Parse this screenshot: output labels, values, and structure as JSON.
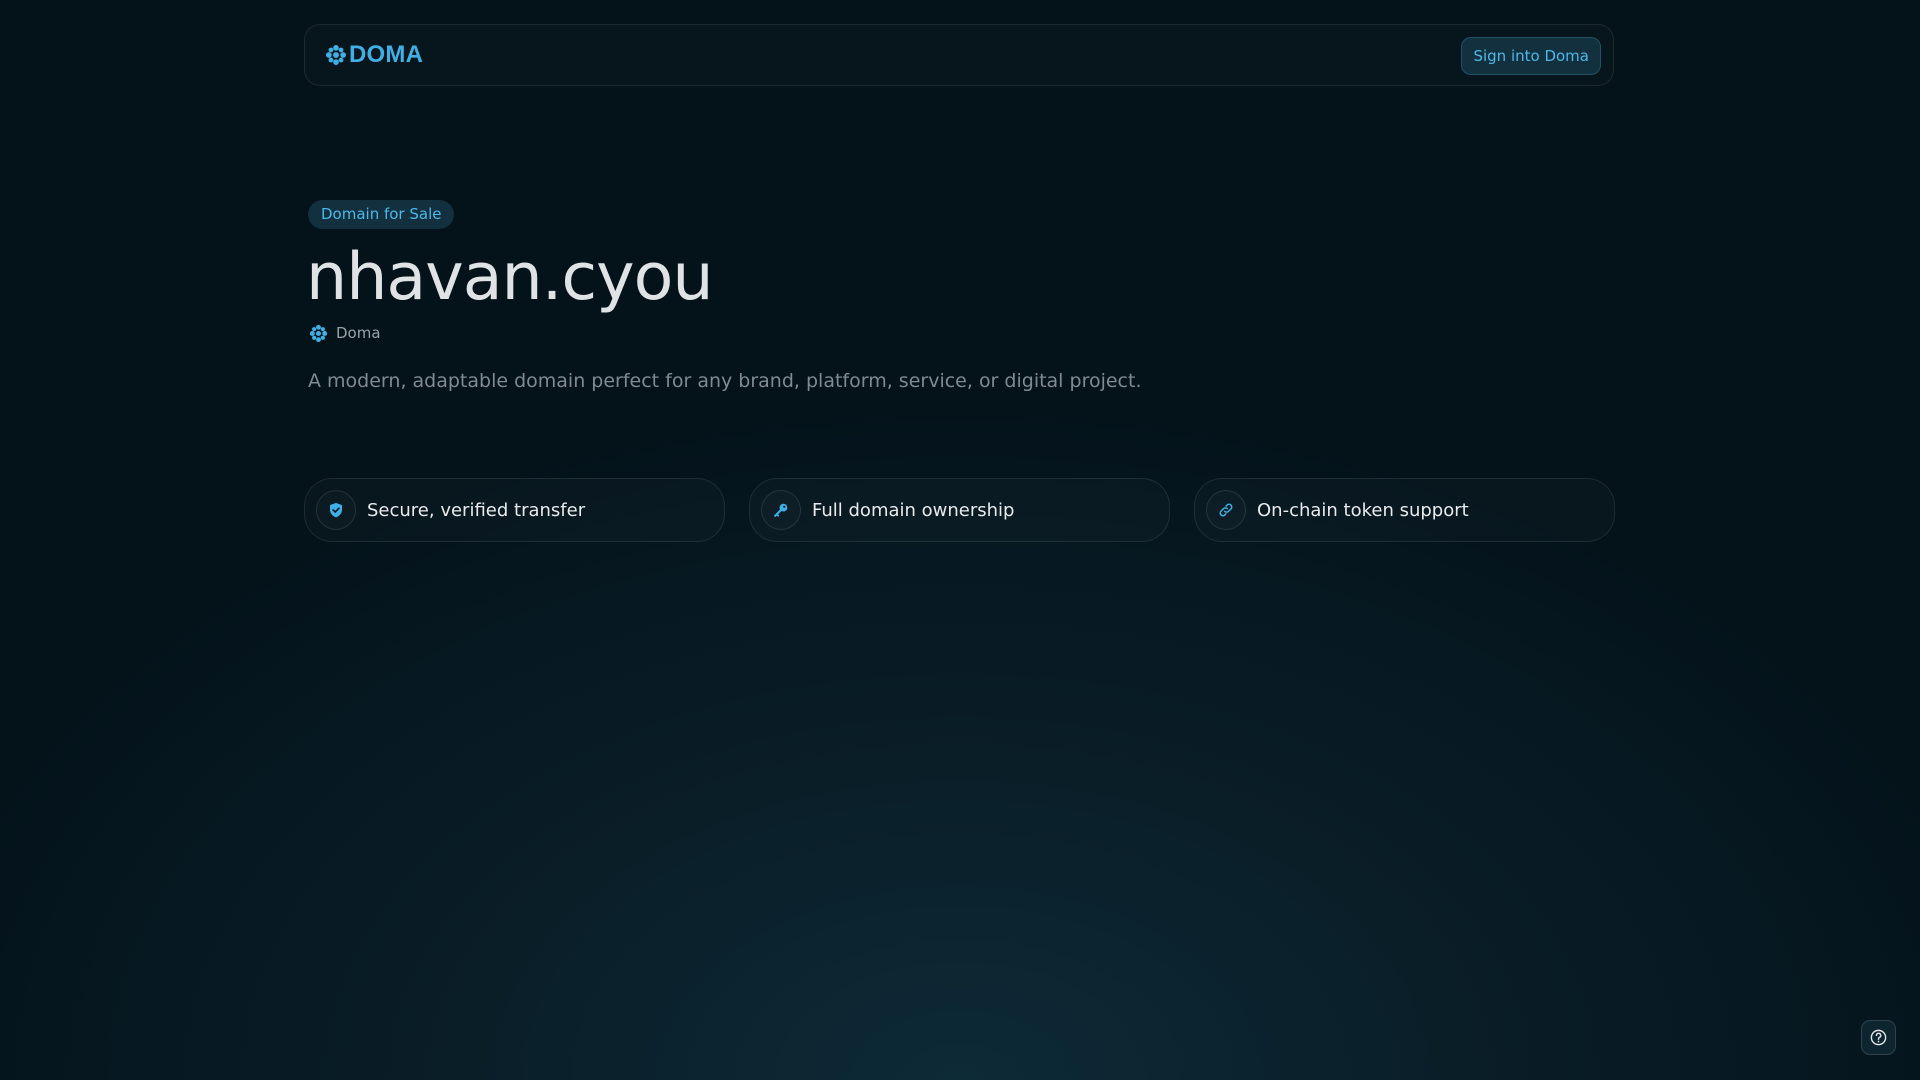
{
  "header": {
    "logo_text": "DOMA",
    "logo_icon": "doma-flower-icon",
    "signin_label": "Sign into Doma"
  },
  "listing": {
    "badge": "Domain for Sale",
    "domain": "nhavan.cyou",
    "registrar": "Doma",
    "registrar_icon": "doma-flower-icon",
    "description": "A modern, adaptable domain perfect for any brand, platform, service, or digital project."
  },
  "features": [
    {
      "icon": "shield-check-icon",
      "label": "Secure, verified transfer"
    },
    {
      "icon": "key-icon",
      "label": "Full domain ownership"
    },
    {
      "icon": "link-icon",
      "label": "On-chain token support"
    }
  ],
  "help": {
    "icon": "help-circle-icon"
  },
  "colors": {
    "accent": "#3fb0e6",
    "background": "#061821",
    "badge_bg": "#12303e",
    "text_primary": "#e8eaec",
    "text_muted": "#7f8a91"
  }
}
